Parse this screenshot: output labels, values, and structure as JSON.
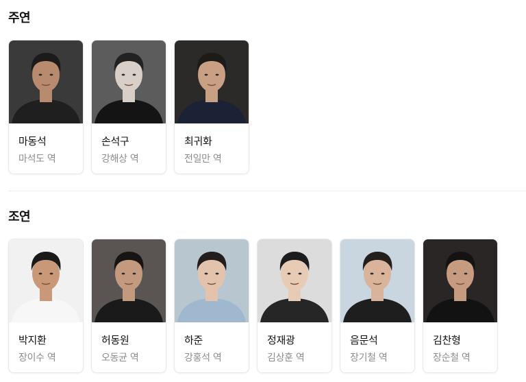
{
  "main_cast": {
    "title": "주연",
    "cast": [
      {
        "name": "마동석",
        "role": "마석도 역",
        "bg": "#3a3a3a",
        "skin": "#b98b6e",
        "hair": "#1b1b1b",
        "shirt": "#1f1f1f"
      },
      {
        "name": "손석구",
        "role": "강해상 역",
        "bg": "#5c5c5c",
        "skin": "#d8d0c8",
        "hair": "#222222",
        "shirt": "#141414"
      },
      {
        "name": "최귀화",
        "role": "전일만 역",
        "bg": "#2b2a28",
        "skin": "#c9a084",
        "hair": "#1d1a17",
        "shirt": "#1c2235"
      }
    ]
  },
  "supporting_cast": {
    "title": "조연",
    "cast": [
      {
        "name": "박지환",
        "role": "장이수 역",
        "bg": "#f1f1f1",
        "skin": "#c99878",
        "hair": "#1a1a1a",
        "shirt": "#f7f7f7"
      },
      {
        "name": "허동원",
        "role": "오동균 역",
        "bg": "#5a5552",
        "skin": "#c49a7e",
        "hair": "#171514",
        "shirt": "#1a1a1a"
      },
      {
        "name": "하준",
        "role": "강홍석 역",
        "bg": "#b8c6cf",
        "skin": "#e4c3ad",
        "hair": "#231e1c",
        "shirt": "#9fb7cf"
      },
      {
        "name": "정재광",
        "role": "김상훈 역",
        "bg": "#dcdcdc",
        "skin": "#e7cbb5",
        "hair": "#1c1c1c",
        "shirt": "#262626"
      },
      {
        "name": "음문석",
        "role": "장기철 역",
        "bg": "#c9d6df",
        "skin": "#d9b49a",
        "hair": "#221f1d",
        "shirt": "#1e1e1e"
      },
      {
        "name": "김찬형",
        "role": "장순철 역",
        "bg": "#2a2626",
        "skin": "#c69b80",
        "hair": "#141212",
        "shirt": "#121212"
      }
    ]
  }
}
